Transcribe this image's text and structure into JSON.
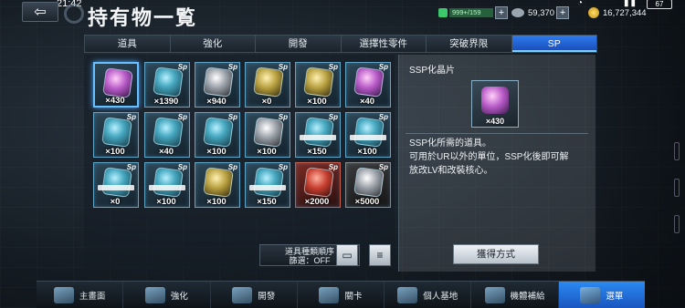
{
  "status": {
    "time": "21:42",
    "battery": "67"
  },
  "header": {
    "title": "持有物一覧",
    "stamina": "999+/159",
    "credits": "59,370",
    "gold": "16,727,344"
  },
  "tabs": [
    "道具",
    "強化",
    "開發",
    "選擇性零件",
    "突破界限",
    "SP"
  ],
  "active_tab": 5,
  "items": [
    {
      "count": "×430"
    },
    {
      "count": "×1390"
    },
    {
      "count": "×940"
    },
    {
      "count": "×0"
    },
    {
      "count": "×100"
    },
    {
      "count": "×40"
    },
    {
      "count": "×100"
    },
    {
      "count": "×40"
    },
    {
      "count": "×100"
    },
    {
      "count": "×100"
    },
    {
      "count": "×150"
    },
    {
      "count": "×100"
    },
    {
      "count": "×0"
    },
    {
      "count": "×100"
    },
    {
      "count": "×100"
    },
    {
      "count": "×150"
    },
    {
      "count": "×2000"
    },
    {
      "count": "×5000"
    }
  ],
  "sort": {
    "label": "道具種類順序",
    "filter": "篩選：OFF"
  },
  "detail": {
    "name": "SSP化晶片",
    "count": "×430",
    "description_line1": "SSP化所需的道具。",
    "description_line2": "可用於UR以外的單位，SSP化後即可解",
    "description_line3": "放改LV和改裝核心。",
    "acquire": "獲得方式"
  },
  "nav": [
    "主畫面",
    "強化",
    "開發",
    "關卡",
    "個人基地",
    "機體補給",
    "選單"
  ],
  "colors": {
    "accent": "#2e7cf0",
    "panel": "#14222c"
  }
}
